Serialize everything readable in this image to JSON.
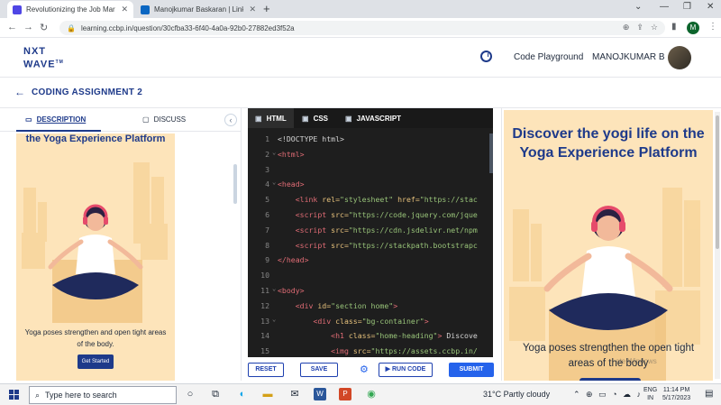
{
  "browser": {
    "tabs": [
      {
        "title": "Revolutionizing the Job Market |",
        "active": true
      },
      {
        "title": "Manojkumar Baskaran | LinkedIn",
        "active": false
      }
    ],
    "url": "learning.ccbp.in/question/30cfba33-6f40-4a0a-92b0-27882ed3f52a",
    "profile_initial": "M"
  },
  "header": {
    "logo_top": "NXT",
    "logo_bottom": "WAVE",
    "logo_tm": "TM",
    "code_playground": "Code Playground",
    "username": "MANOJKUMAR B"
  },
  "assignment": {
    "title": "CODING ASSIGNMENT 2"
  },
  "left_tabs": {
    "description": "DESCRIPTION",
    "discuss": "DISCUSS"
  },
  "preview_small": {
    "heading": "the Yoga Experience Platform",
    "text": "Yoga poses strengthen and open tight areas of the body.",
    "button": "Get Started"
  },
  "editor": {
    "tabs": [
      "HTML",
      "CSS",
      "JAVASCRIPT"
    ],
    "lines": [
      {
        "n": "1",
        "fold": "",
        "parts": [
          {
            "c": "t-text",
            "t": "<!DOCTYPE html>"
          }
        ]
      },
      {
        "n": "2",
        "fold": "⌄",
        "parts": [
          {
            "c": "t-tag",
            "t": "<html>"
          }
        ]
      },
      {
        "n": "3",
        "fold": "",
        "parts": []
      },
      {
        "n": "4",
        "fold": "⌄",
        "parts": [
          {
            "c": "t-tag",
            "t": "<head>"
          }
        ]
      },
      {
        "n": "5",
        "fold": "",
        "parts": [
          {
            "c": "t-text",
            "t": "    "
          },
          {
            "c": "t-tag",
            "t": "<link "
          },
          {
            "c": "t-attr",
            "t": "rel="
          },
          {
            "c": "t-str",
            "t": "\"stylesheet\" "
          },
          {
            "c": "t-attr",
            "t": "href="
          },
          {
            "c": "t-str",
            "t": "\"https://stac"
          }
        ]
      },
      {
        "n": "6",
        "fold": "",
        "parts": [
          {
            "c": "t-text",
            "t": "    "
          },
          {
            "c": "t-tag",
            "t": "<script "
          },
          {
            "c": "t-attr",
            "t": "src="
          },
          {
            "c": "t-str",
            "t": "\"https://code.jquery.com/jque"
          }
        ]
      },
      {
        "n": "7",
        "fold": "",
        "parts": [
          {
            "c": "t-text",
            "t": "    "
          },
          {
            "c": "t-tag",
            "t": "<script "
          },
          {
            "c": "t-attr",
            "t": "src="
          },
          {
            "c": "t-str",
            "t": "\"https://cdn.jsdelivr.net/npm"
          }
        ]
      },
      {
        "n": "8",
        "fold": "",
        "parts": [
          {
            "c": "t-text",
            "t": "    "
          },
          {
            "c": "t-tag",
            "t": "<script "
          },
          {
            "c": "t-attr",
            "t": "src="
          },
          {
            "c": "t-str",
            "t": "\"https://stackpath.bootstrapc"
          }
        ]
      },
      {
        "n": "9",
        "fold": "",
        "parts": [
          {
            "c": "t-tag",
            "t": "</head>"
          }
        ]
      },
      {
        "n": "10",
        "fold": "",
        "parts": []
      },
      {
        "n": "11",
        "fold": "⌄",
        "parts": [
          {
            "c": "t-tag",
            "t": "<body>"
          }
        ]
      },
      {
        "n": "12",
        "fold": "",
        "parts": [
          {
            "c": "t-text",
            "t": "    "
          },
          {
            "c": "t-tag",
            "t": "<div "
          },
          {
            "c": "t-attr",
            "t": "id="
          },
          {
            "c": "t-str",
            "t": "\"section home\""
          },
          {
            "c": "t-tag",
            "t": ">"
          }
        ]
      },
      {
        "n": "13",
        "fold": "⌄",
        "parts": [
          {
            "c": "t-text",
            "t": "        "
          },
          {
            "c": "t-tag",
            "t": "<div "
          },
          {
            "c": "t-attr",
            "t": "class="
          },
          {
            "c": "t-str",
            "t": "\"bg-container\""
          },
          {
            "c": "t-tag",
            "t": ">"
          }
        ]
      },
      {
        "n": "14",
        "fold": "",
        "parts": [
          {
            "c": "t-text",
            "t": "            "
          },
          {
            "c": "t-tag",
            "t": "<h1 "
          },
          {
            "c": "t-attr",
            "t": "class="
          },
          {
            "c": "t-str",
            "t": "\"home-heading\""
          },
          {
            "c": "t-tag",
            "t": ">"
          },
          {
            "c": "t-text",
            "t": " Discove"
          }
        ]
      },
      {
        "n": "15",
        "fold": "",
        "parts": [
          {
            "c": "t-text",
            "t": "            "
          },
          {
            "c": "t-tag",
            "t": "<img "
          },
          {
            "c": "t-attr",
            "t": "src="
          },
          {
            "c": "t-str",
            "t": "\"https://assets.ccbp.in/"
          }
        ]
      }
    ]
  },
  "actions": {
    "reset": "RESET",
    "save": "SAVE",
    "run": "▶ RUN CODE",
    "submit": "SUBMIT"
  },
  "preview_large": {
    "heading": "Discover the yogi life on the Yoga Experience Platform",
    "text": "Yoga poses strengthen the open tight areas of the body",
    "watermark": "ate Windows"
  },
  "taskbar": {
    "search_placeholder": "Type here to search",
    "weather": "31°C  Partly cloudy",
    "lang_top": "ENG",
    "lang_bottom": "IN",
    "time": "11:14 PM",
    "date": "5/17/2023"
  },
  "colors": {
    "brand": "#1e3a8a",
    "accent": "#2563eb",
    "preview_bg": "#fde4ba",
    "editor_bg": "#1e1e1e"
  }
}
